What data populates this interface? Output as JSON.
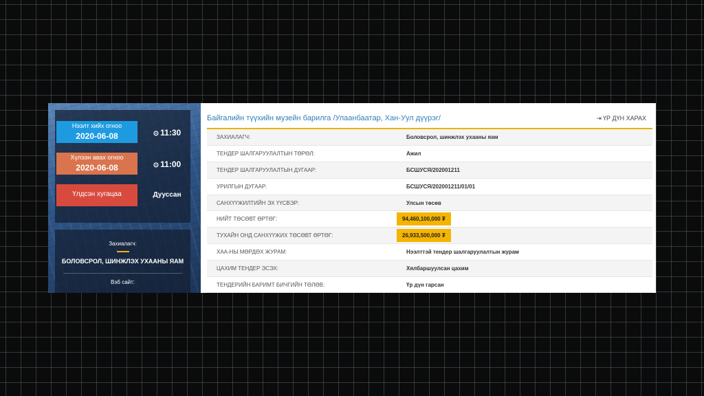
{
  "left_panel": {
    "publish_label": "Нээлт хийх огноо",
    "publish_date": "2020-06-08",
    "publish_time": "11:30",
    "receive_label": "Хүлээн авах огноо",
    "receive_date": "2020-06-08",
    "receive_time": "11:00",
    "remaining_label": "Үлдсэн хугацаа",
    "remaining_value": "Дууссан",
    "clock_icon": "clock-icon",
    "client_label": "Захиалагч:",
    "client_name": "БОЛОВСРОЛ, ШИНЖЛЭХ УХААНЫ ЯАМ",
    "website_label": "Вэб сайт:"
  },
  "header": {
    "title": "Байгалийн түүхийн музейн барилга /Улаанбаатар, Хан-Уул дүүрэг/",
    "result_button": "ҮР ДҮН ХАРАХ",
    "result_icon": "sign-out-icon"
  },
  "details": [
    {
      "key": "ЗАХИАЛАГЧ:",
      "value": "Боловсрол, шинжлэх ухааны яам"
    },
    {
      "key": "ТЕНДЕР ШАЛГАРУУЛАЛТЫН ТӨРӨЛ:",
      "value": "Ажил"
    },
    {
      "key": "ТЕНДЕР ШАЛГАРУУЛАЛТЫН ДУГААР:",
      "value": "БСШУСЯ/202001211"
    },
    {
      "key": "УРИЛГЫН ДУГААР:",
      "value": "БСШУСЯ/202001211/01/01"
    },
    {
      "key": "САНХҮҮЖИЛТИЙН ЭХ ҮҮСВЭР:",
      "value": "Улсын төсөв"
    },
    {
      "key": "НИЙТ ТӨСӨВТ ӨРТӨГ:",
      "value": "94,460,100,000 ₮"
    },
    {
      "key": "ТУХАЙН ОНД САНХҮҮЖИХ ТӨСӨВТ ӨРТӨГ:",
      "value": "26,933,500,000 ₮"
    },
    {
      "key": "ХАА-НЫ МӨРДӨХ ЖУРАМ:",
      "value": "Нээлттэй тендер шалгаруулалтын журам"
    },
    {
      "key": "ЦАХИМ ТЕНДЕР ЭСЭХ:",
      "value": "Хялбаршуулсан цахим"
    },
    {
      "key": "ТЕНДЕРИЙН БАРИМТ БИЧГИЙН ТӨЛӨВ:",
      "value": "Үр дүн гарсан"
    }
  ],
  "colors": {
    "accent": "#f4b400",
    "title": "#2f7fb8",
    "publish": "#1e9be0",
    "receive": "#d9744e",
    "remaining": "#d94a3e"
  }
}
